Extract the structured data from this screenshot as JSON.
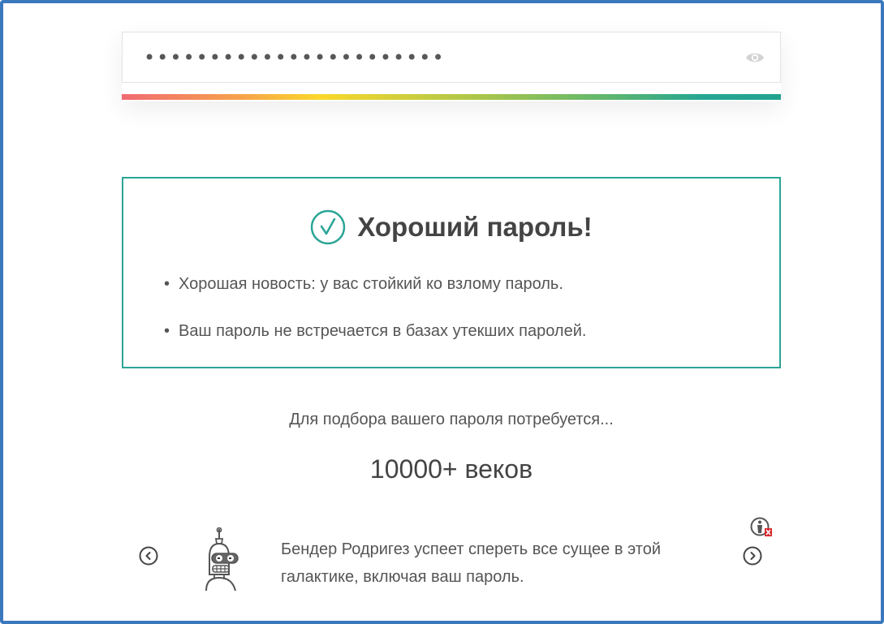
{
  "password": {
    "masked_value": "•••••••••••••••••••••••"
  },
  "result": {
    "title": "Хороший пароль!",
    "bullets": [
      "Хорошая новость: у вас стойкий ко взлому пароль.",
      "Ваш пароль не встречается в базах утекших паролей."
    ],
    "accent_color": "#2aa596"
  },
  "crack": {
    "label": "Для подбора вашего пароля потребуется...",
    "time": "10000+ веков"
  },
  "carousel": {
    "text": "Бендер Родригез успеет спереть все сущее в этой галактике, включая ваш пароль.",
    "image": "bender-robot"
  },
  "colors": {
    "frame_border": "#3b78bd",
    "text": "#555555",
    "strength_start": "#f06a72",
    "strength_end": "#22a38f"
  }
}
